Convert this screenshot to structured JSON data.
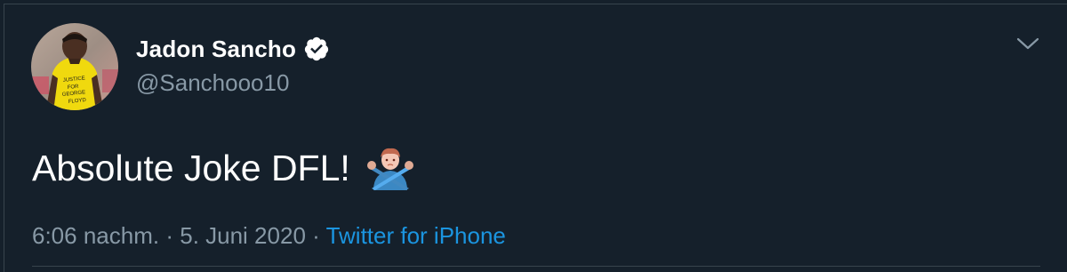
{
  "tweet": {
    "author_name": "Jadon Sancho",
    "author_handle": "@Sanchooo10",
    "text": "Absolute Joke DFL!",
    "time": "6:06 nachm.",
    "sep1": "·",
    "date": "5. Juni 2020",
    "sep2": "·",
    "source": "Twitter for iPhone",
    "avatar_shirt_text": "JUSTICE FOR GEORGE FLOYD"
  },
  "icons": {
    "verified": "verified-badge-icon",
    "menu": "chevron-down-icon",
    "emoji": "person-gesturing-no-emoji"
  },
  "colors": {
    "background": "#15202b",
    "text": "#ffffff",
    "secondary": "#8899a6",
    "link": "#1b95e0",
    "border": "#38444d"
  }
}
